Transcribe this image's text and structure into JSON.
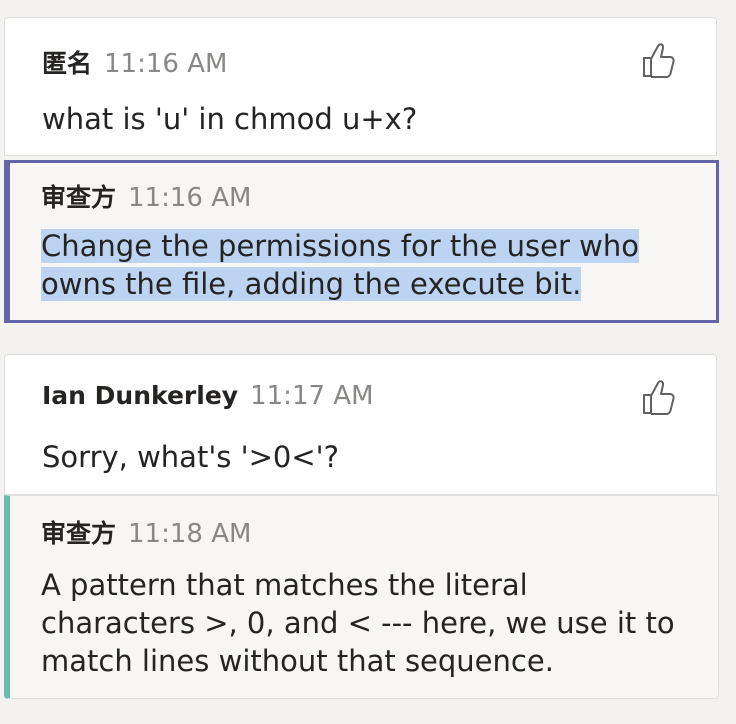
{
  "messages": [
    {
      "author": "匿名",
      "time": "11:16 AM",
      "text": "what is 'u' in chmod u+x?",
      "like_icon": "thumbs-up-icon",
      "reply": {
        "author": "审查方",
        "time": "11:16 AM",
        "text_line1": "Change the permissions for the user who",
        "text_line2": "owns the file, adding the execute bit."
      }
    },
    {
      "author": "Ian Dunkerley",
      "time": "11:17 AM",
      "text": "Sorry, what's '>0<'?",
      "like_icon": "thumbs-up-icon",
      "reply": {
        "author": "审查方",
        "time": "11:18 AM",
        "text_line1": "A pattern that matches the literal",
        "text_line2": "characters >, 0, and < --- here, we use it to",
        "text_line3": "match lines without that sequence."
      }
    }
  ],
  "colors": {
    "background": "#f3f2f1",
    "card": "#ffffff",
    "reply_background": "#f7f6f5",
    "focus_border": "#6264a7",
    "reply_accent": "#6bbbad",
    "selection": "#bcd4f2",
    "timestamp": "#8a8886"
  }
}
